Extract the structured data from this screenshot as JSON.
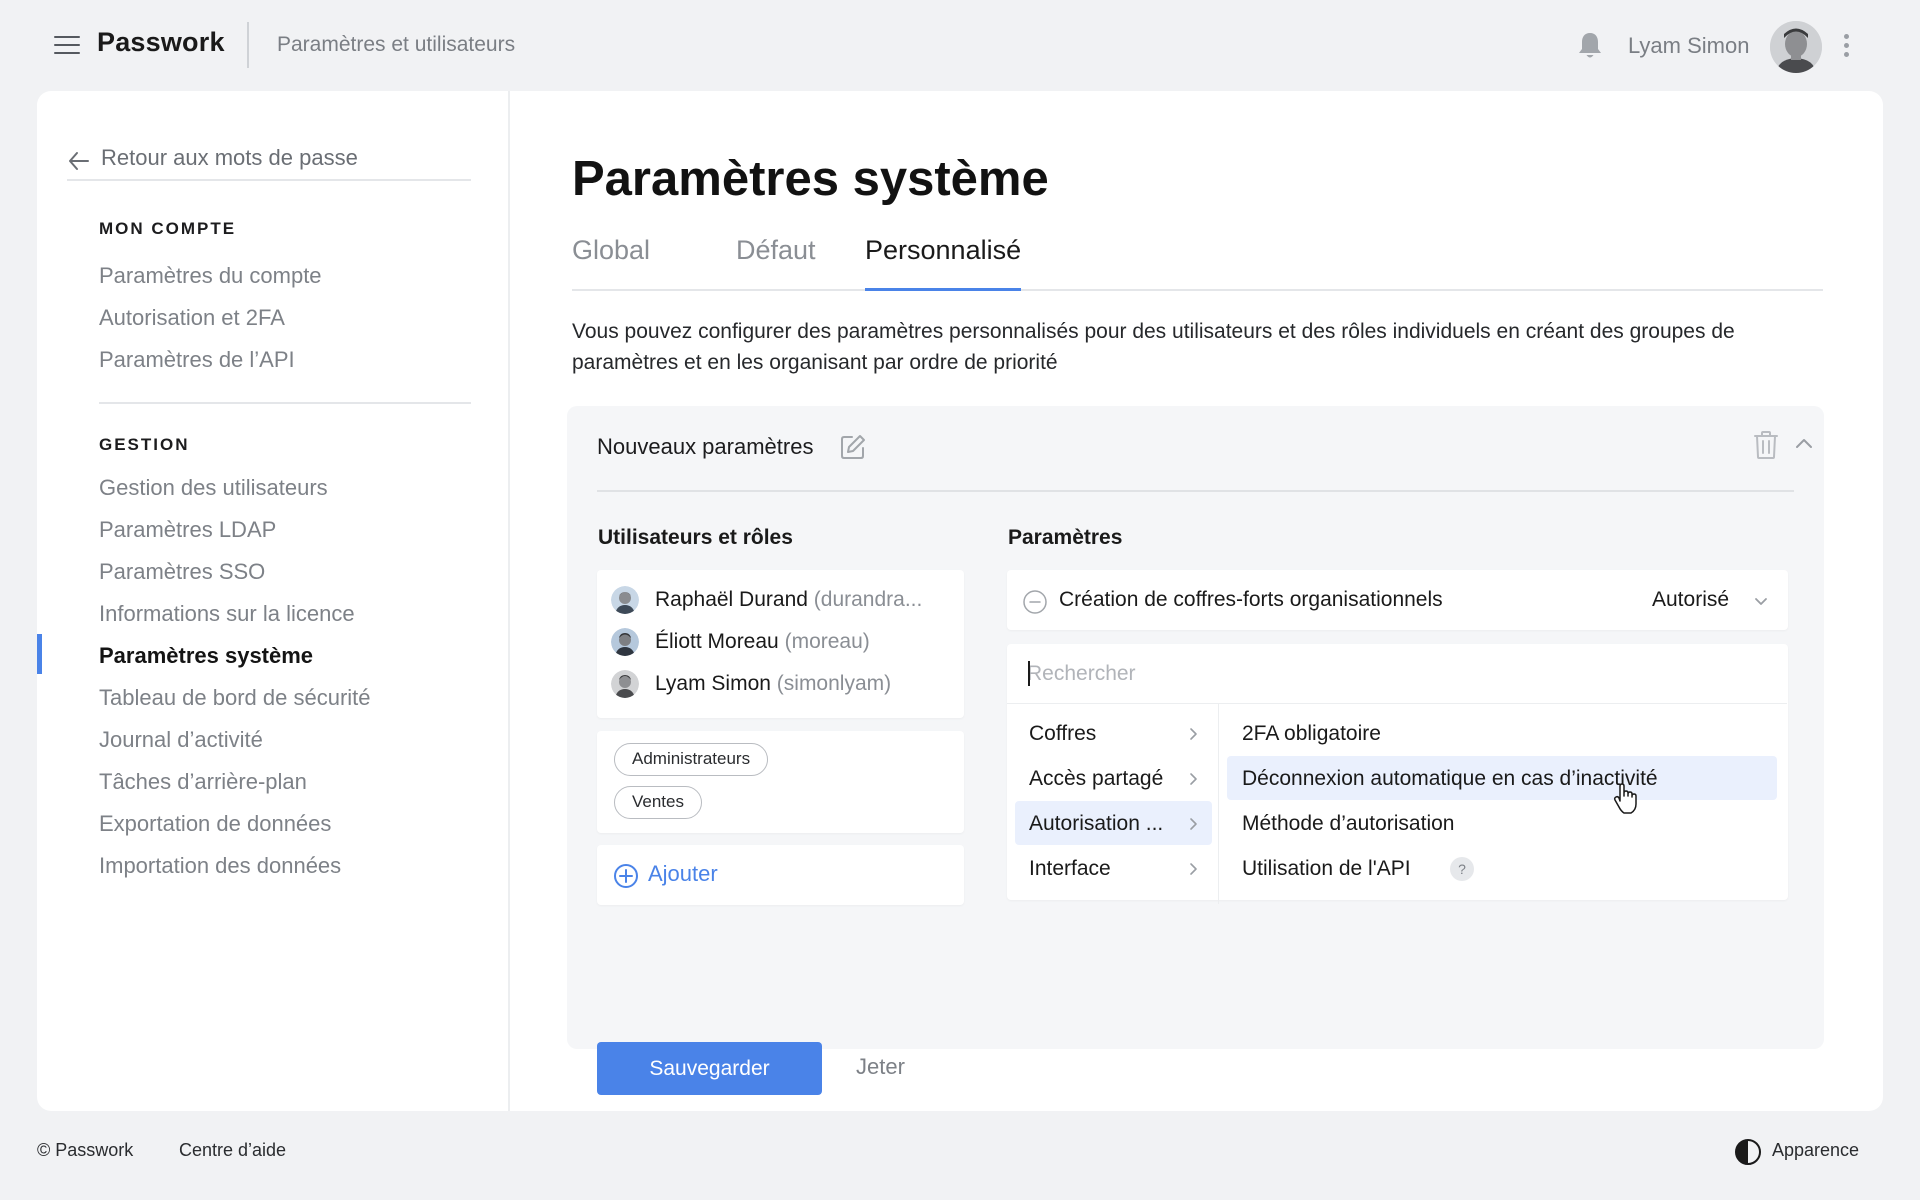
{
  "topbar": {
    "brand": "Passwork",
    "breadcrumb": "Paramètres et utilisateurs",
    "username": "Lyam Simon"
  },
  "sidebar": {
    "back_label": "Retour aux mots de passe",
    "sections": [
      {
        "title": "MON COMPTE",
        "items": [
          "Paramètres du compte",
          "Autorisation et 2FA",
          "Paramètres de l’API"
        ]
      },
      {
        "title": "GESTION",
        "items": [
          "Gestion des utilisateurs",
          "Paramètres LDAP",
          "Paramètres SSO",
          "Informations sur la licence",
          "Paramètres système",
          "Tableau de bord de sécurité",
          "Journal d’activité",
          "Tâches d’arrière-plan",
          "Exportation de données",
          "Importation des données"
        ]
      }
    ],
    "active_item": "Paramètres système"
  },
  "main": {
    "title": "Paramètres système",
    "tabs": [
      "Global",
      "Défaut",
      "Personnalisé"
    ],
    "active_tab": "Personnalisé",
    "description": "Vous pouvez configurer des paramètres personnalisés pour des utilisateurs et des rôles individuels en créant des groupes de paramètres et en les organisant par ordre de priorité",
    "group": {
      "name": "Nouveaux paramètres",
      "users_title": "Utilisateurs et rôles",
      "users": [
        {
          "name": "Raphaël Durand",
          "login": "(durandra..."
        },
        {
          "name": "Éliott Moreau",
          "login": "(moreau)"
        },
        {
          "name": "Lyam Simon",
          "login": "(simonlyam)"
        }
      ],
      "roles": [
        "Administrateurs",
        "Ventes"
      ],
      "add_label": "Ajouter",
      "params_title": "Paramètres",
      "param": {
        "label": "Création de coffres-forts organisationnels",
        "value": "Autorisé"
      },
      "search_placeholder": "Rechercher",
      "categories": [
        "Coffres",
        "Accès partagé",
        "Autorisation ...",
        "Interface"
      ],
      "active_category": "Autorisation ...",
      "options": [
        "2FA obligatoire",
        "Déconnexion automatique en cas d’inactivité",
        "Méthode d’autorisation",
        "Utilisation de l'API"
      ],
      "help_glyph": "?",
      "save_label": "Sauvegarder",
      "discard_label": "Jeter"
    }
  },
  "footer": {
    "copyright": "© Passwork",
    "help": "Centre d’aide",
    "appearance": "Apparence"
  },
  "colors": {
    "accent": "#4a83e8",
    "background": "#f1f2f4",
    "highlight": "#eaf0fd"
  }
}
